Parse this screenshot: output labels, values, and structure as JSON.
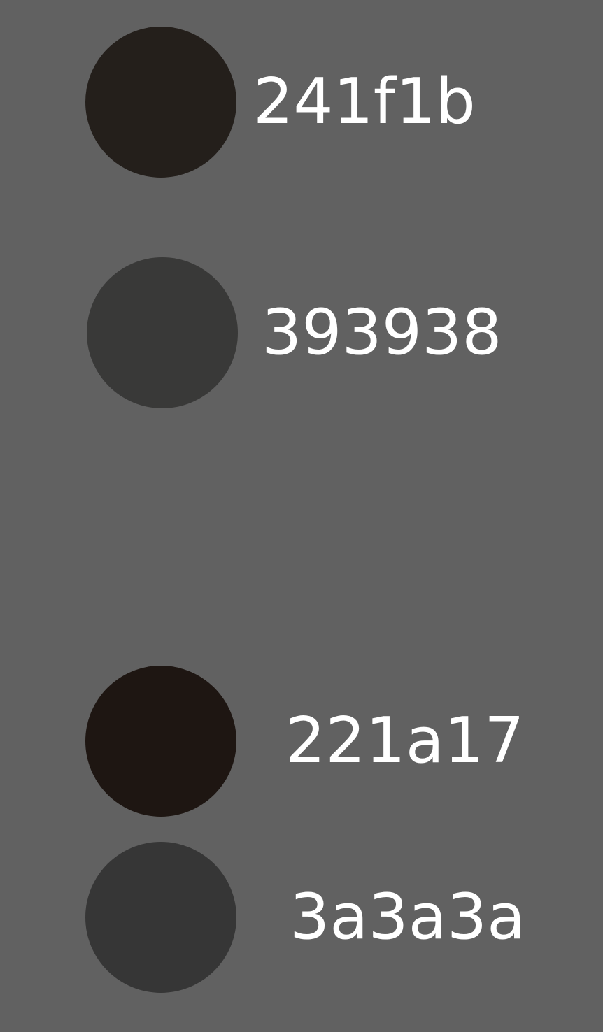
{
  "swatches": [
    {
      "label": "241f1b",
      "color": "#241f1b"
    },
    {
      "label": "393938",
      "color": "#393938"
    },
    {
      "label": "221a17",
      "color": "#1e1612"
    },
    {
      "label": "3a3a3a",
      "color": "#363636"
    }
  ],
  "colors": {
    "background": "#616161",
    "text": "#ffffff"
  }
}
